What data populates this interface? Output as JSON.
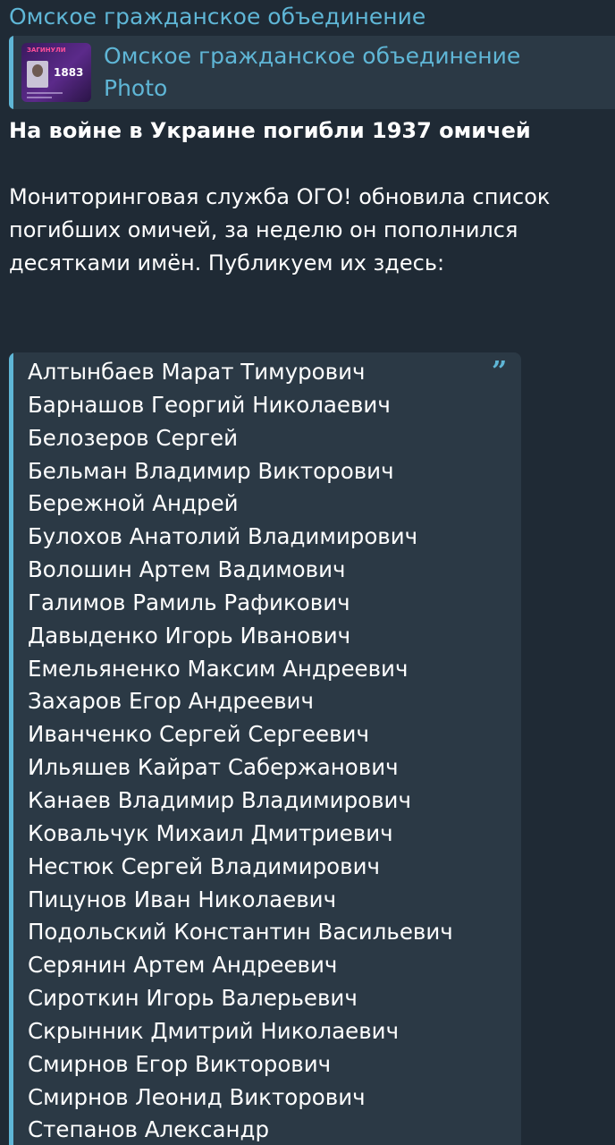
{
  "sender": {
    "name": "Омское гражданское объединение"
  },
  "reply": {
    "title": "Омское гражданское объединение",
    "subtitle": "Photo",
    "thumbnail": {
      "tag": "ЗАГИНУЛИ",
      "count": "1883"
    }
  },
  "message": {
    "headline": "На войне в Украине погибли 1937 омичей",
    "body_lines": [
      "Мониторинговая служба ОГО! обновила список",
      "погибших омичей, за неделю он пополнился",
      "десятками имён. Публикуем их здесь:"
    ]
  },
  "quote": {
    "icon": "quote-icon",
    "names": [
      "Алтынбаев Марат Тимурович",
      "Барнашов Георгий Николаевич",
      "Белозеров Сергей",
      "Бельман Владимир Викторович",
      "Бережной Андрей",
      "Булохов Анатолий Владимирович",
      "Волошин Артем Вадимович",
      "Галимов Рамиль Рафикович",
      "Давыденко Игорь Иванович",
      "Емельяненко Максим Андреевич",
      "Захаров Егор Андреевич",
      "Иванченко Сергей Сергеевич",
      "Ильяшев Кайрат Сабержанович",
      "Канаев Владимир Владимирович",
      "Ковальчук Михаил Дмитриевич",
      "Нестюк Сергей Владимирович",
      "Пицунов Иван Николаевич",
      "Подольский Константин Васильевич",
      "Серянин Артем Андреевич",
      "Сироткин Игорь Валерьевич",
      "Скрынник Дмитрий Николаевич",
      "Смирнов Егор Викторович",
      "Смирнов Леонид Викторович",
      "Степанов Александр"
    ]
  },
  "colors": {
    "background": "#1f2a35",
    "bubble": "#2b3945",
    "accent": "#5fb6d6",
    "text": "#ffffff"
  }
}
